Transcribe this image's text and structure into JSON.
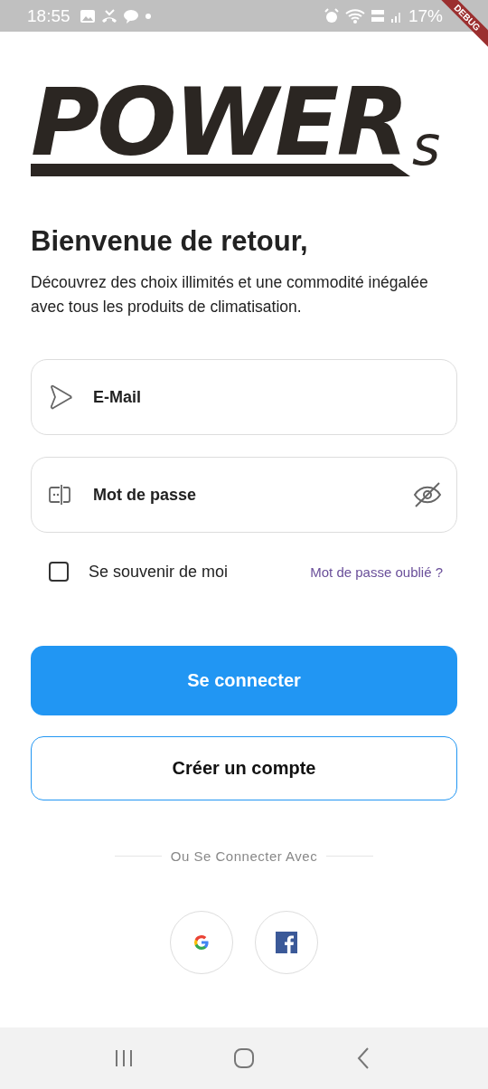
{
  "status_bar": {
    "time": "18:55",
    "battery": "17%"
  },
  "debug_banner": {
    "label": "DEBUG"
  },
  "logo": {
    "main": "POWER",
    "suffix": "s"
  },
  "heading": "Bienvenue de retour,",
  "intro": "Découvrez des choix illimités et une commodité inégalée avec tous les produits de climatisation.",
  "email_field": {
    "placeholder": "E-Mail"
  },
  "password_field": {
    "placeholder": "Mot de passe",
    "password_visible": false
  },
  "remember_me": {
    "label": "Se souvenir de moi",
    "checked": false
  },
  "forgot_link": "Mot de passe oublié ?",
  "login_button": "Se connecter",
  "signup_button": "Créer un compte",
  "divider_text": "Ou Se Connecter Avec",
  "social_buttons": [
    {
      "kind": "google"
    },
    {
      "kind": "facebook"
    }
  ]
}
